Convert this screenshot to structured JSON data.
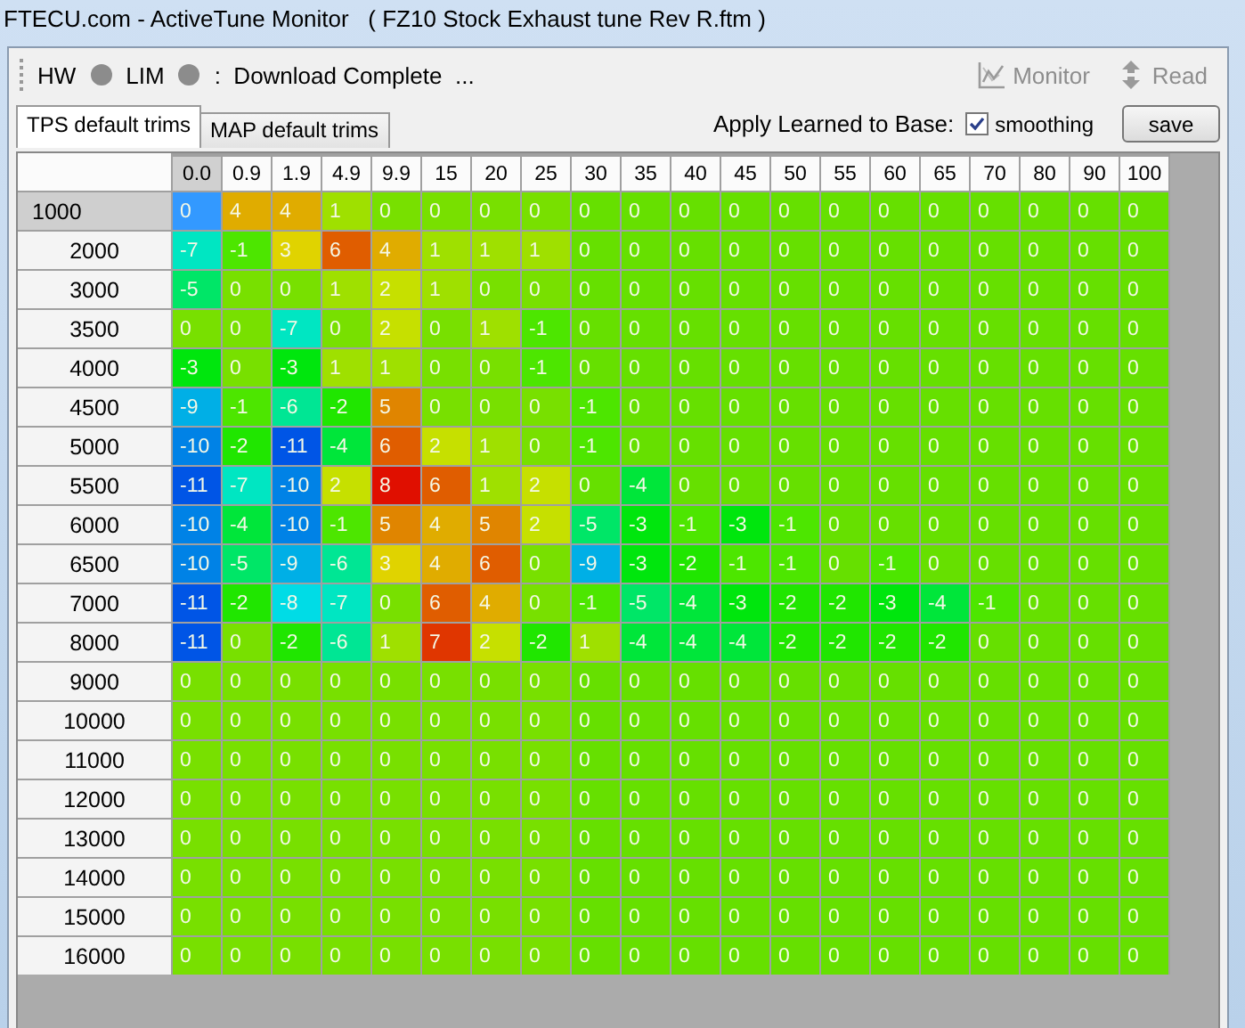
{
  "window": {
    "title": "FTECU.com - ActiveTune Monitor   ( FZ10 Stock Exhaust tune Rev R.ftm )"
  },
  "toolbar": {
    "indicators": [
      {
        "label": "HW",
        "on": false
      },
      {
        "label": "LIM",
        "on": false
      }
    ],
    "status": ":  Download Complete  ...",
    "buttons": [
      {
        "kind": "monitor",
        "label": "Monitor",
        "disabled": true
      },
      {
        "kind": "read",
        "label": "Read",
        "disabled": true
      }
    ]
  },
  "tabs": [
    {
      "label": "TPS default trims",
      "selected": true
    },
    {
      "label": "MAP default trims",
      "selected": false
    }
  ],
  "apply": {
    "label": "Apply Learned to Base:",
    "checkbox": {
      "label": "smoothing",
      "checked": true
    },
    "button": "save"
  },
  "table": {
    "columns": [
      {
        "label": "0.0",
        "selected": true
      },
      {
        "label": "0.9",
        "selected": false
      },
      {
        "label": "1.9",
        "selected": false
      },
      {
        "label": "4.9",
        "selected": false
      },
      {
        "label": "9.9",
        "selected": false
      },
      {
        "label": "15",
        "selected": false
      },
      {
        "label": "20",
        "selected": false
      },
      {
        "label": "25",
        "selected": false
      },
      {
        "label": "30",
        "selected": false
      },
      {
        "label": "35",
        "selected": false
      },
      {
        "label": "40",
        "selected": false
      },
      {
        "label": "45",
        "selected": false
      },
      {
        "label": "50",
        "selected": false
      },
      {
        "label": "55",
        "selected": false
      },
      {
        "label": "60",
        "selected": false
      },
      {
        "label": "65",
        "selected": false
      },
      {
        "label": "70",
        "selected": false
      },
      {
        "label": "80",
        "selected": false
      },
      {
        "label": "90",
        "selected": false
      },
      {
        "label": "100",
        "selected": false
      }
    ],
    "rows": [
      {
        "label": "1000",
        "selected": true,
        "cells": [
          "0",
          "4",
          "4",
          "1",
          "0",
          "0",
          "0",
          "0",
          "0",
          "0",
          "0",
          "0",
          "0",
          "0",
          "0",
          "0",
          "0",
          "0",
          "0",
          "0"
        ]
      },
      {
        "label": "2000",
        "selected": false,
        "cells": [
          "-7",
          "-1",
          "3",
          "6",
          "4",
          "1",
          "1",
          "1",
          "0",
          "0",
          "0",
          "0",
          "0",
          "0",
          "0",
          "0",
          "0",
          "0",
          "0",
          "0"
        ]
      },
      {
        "label": "3000",
        "selected": false,
        "cells": [
          "-5",
          "0",
          "0",
          "1",
          "2",
          "1",
          "0",
          "0",
          "0",
          "0",
          "0",
          "0",
          "0",
          "0",
          "0",
          "0",
          "0",
          "0",
          "0",
          "0"
        ]
      },
      {
        "label": "3500",
        "selected": false,
        "cells": [
          "0",
          "0",
          "-7",
          "0",
          "2",
          "0",
          "1",
          "-1",
          "0",
          "0",
          "0",
          "0",
          "0",
          "0",
          "0",
          "0",
          "0",
          "0",
          "0",
          "0"
        ]
      },
      {
        "label": "4000",
        "selected": false,
        "cells": [
          "-3",
          "0",
          "-3",
          "1",
          "1",
          "0",
          "0",
          "-1",
          "0",
          "0",
          "0",
          "0",
          "0",
          "0",
          "0",
          "0",
          "0",
          "0",
          "0",
          "0"
        ]
      },
      {
        "label": "4500",
        "selected": false,
        "cells": [
          "-9",
          "-1",
          "-6",
          "-2",
          "5",
          "0",
          "0",
          "0",
          "-1",
          "0",
          "0",
          "0",
          "0",
          "0",
          "0",
          "0",
          "0",
          "0",
          "0",
          "0"
        ]
      },
      {
        "label": "5000",
        "selected": false,
        "cells": [
          "-10",
          "-2",
          "-11",
          "-4",
          "6",
          "2",
          "1",
          "0",
          "-1",
          "0",
          "0",
          "0",
          "0",
          "0",
          "0",
          "0",
          "0",
          "0",
          "0",
          "0"
        ]
      },
      {
        "label": "5500",
        "selected": false,
        "cells": [
          "-11",
          "-7",
          "-10",
          "2",
          "8",
          "6",
          "1",
          "2",
          "0",
          "-4",
          "0",
          "0",
          "0",
          "0",
          "0",
          "0",
          "0",
          "0",
          "0",
          "0"
        ]
      },
      {
        "label": "6000",
        "selected": false,
        "cells": [
          "-10",
          "-4",
          "-10",
          "-1",
          "5",
          "4",
          "5",
          "2",
          "-5",
          "-3",
          "-1",
          "-3",
          "-1",
          "0",
          "0",
          "0",
          "0",
          "0",
          "0",
          "0"
        ]
      },
      {
        "label": "6500",
        "selected": false,
        "cells": [
          "-10",
          "-5",
          "-9",
          "-6",
          "3",
          "4",
          "6",
          "0",
          "-9",
          "-3",
          "-2",
          "-1",
          "-1",
          "0",
          "-1",
          "0",
          "0",
          "0",
          "0",
          "0"
        ]
      },
      {
        "label": "7000",
        "selected": false,
        "cells": [
          "-11",
          "-2",
          "-8",
          "-7",
          "0",
          "6",
          "4",
          "0",
          "-1",
          "-5",
          "-4",
          "-3",
          "-2",
          "-2",
          "-3",
          "-4",
          "-1",
          "0",
          "0",
          "0"
        ]
      },
      {
        "label": "8000",
        "selected": false,
        "cells": [
          "-11",
          "0",
          "-2",
          "-6",
          "1",
          "7",
          "2",
          "-2",
          "1",
          "-4",
          "-4",
          "-4",
          "-2",
          "-2",
          "-2",
          "-2",
          "0",
          "0",
          "0",
          "0"
        ]
      },
      {
        "label": "9000",
        "selected": false,
        "cells": [
          "0",
          "0",
          "0",
          "0",
          "0",
          "0",
          "0",
          "0",
          "0",
          "0",
          "0",
          "0",
          "0",
          "0",
          "0",
          "0",
          "0",
          "0",
          "0",
          "0"
        ]
      },
      {
        "label": "10000",
        "selected": false,
        "cells": [
          "0",
          "0",
          "0",
          "0",
          "0",
          "0",
          "0",
          "0",
          "0",
          "0",
          "0",
          "0",
          "0",
          "0",
          "0",
          "0",
          "0",
          "0",
          "0",
          "0"
        ]
      },
      {
        "label": "11000",
        "selected": false,
        "cells": [
          "0",
          "0",
          "0",
          "0",
          "0",
          "0",
          "0",
          "0",
          "0",
          "0",
          "0",
          "0",
          "0",
          "0",
          "0",
          "0",
          "0",
          "0",
          "0",
          "0"
        ]
      },
      {
        "label": "12000",
        "selected": false,
        "cells": [
          "0",
          "0",
          "0",
          "0",
          "0",
          "0",
          "0",
          "0",
          "0",
          "0",
          "0",
          "0",
          "0",
          "0",
          "0",
          "0",
          "0",
          "0",
          "0",
          "0"
        ]
      },
      {
        "label": "13000",
        "selected": false,
        "cells": [
          "0",
          "0",
          "0",
          "0",
          "0",
          "0",
          "0",
          "0",
          "0",
          "0",
          "0",
          "0",
          "0",
          "0",
          "0",
          "0",
          "0",
          "0",
          "0",
          "0"
        ]
      },
      {
        "label": "14000",
        "selected": false,
        "cells": [
          "0",
          "0",
          "0",
          "0",
          "0",
          "0",
          "0",
          "0",
          "0",
          "0",
          "0",
          "0",
          "0",
          "0",
          "0",
          "0",
          "0",
          "0",
          "0",
          "0"
        ]
      },
      {
        "label": "15000",
        "selected": false,
        "cells": [
          "0",
          "0",
          "0",
          "0",
          "0",
          "0",
          "0",
          "0",
          "0",
          "0",
          "0",
          "0",
          "0",
          "0",
          "0",
          "0",
          "0",
          "0",
          "0",
          "0"
        ]
      },
      {
        "label": "16000",
        "selected": false,
        "cells": [
          "0",
          "0",
          "0",
          "0",
          "0",
          "0",
          "0",
          "0",
          "0",
          "0",
          "0",
          "0",
          "0",
          "0",
          "0",
          "0",
          "0",
          "0",
          "0",
          "0"
        ]
      }
    ]
  }
}
